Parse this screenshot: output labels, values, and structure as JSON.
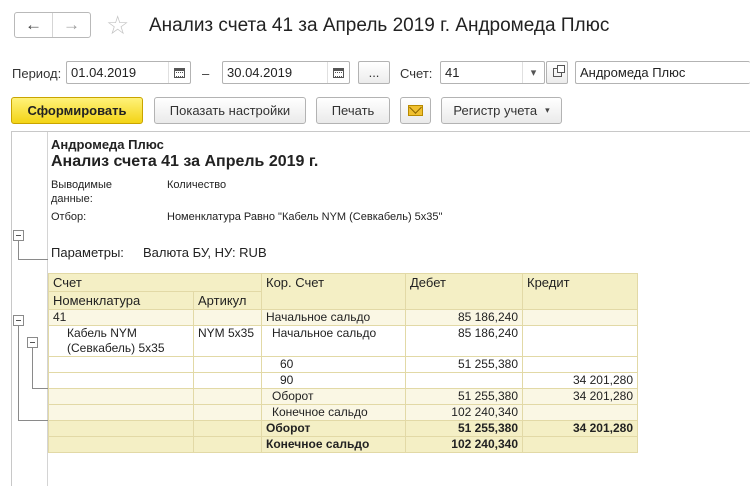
{
  "window": {
    "title": "Анализ счета 41 за Апрель 2019 г. Андромеда Плюс",
    "back_icon": "←",
    "forward_icon": "→",
    "star_icon": "☆"
  },
  "filters": {
    "period_label": "Период:",
    "date_from": "01.04.2019",
    "dash": "–",
    "date_to": "30.04.2019",
    "period_choose": "...",
    "account_label": "Счет:",
    "account_value": "41",
    "account_dropdown_icon": "▾",
    "organization": "Андромеда Плюс"
  },
  "toolbar": {
    "generate_label": "Сформировать",
    "settings_label": "Показать настройки",
    "print_label": "Печать",
    "register_label": "Регистр учета",
    "register_caret": "▾"
  },
  "report": {
    "organization": "Андромеда Плюс",
    "title": "Анализ счета 41 за Апрель 2019 г.",
    "output_label_1": "Выводимые",
    "output_label_2": "данные:",
    "output_value": "Количество",
    "filter_label": "Отбор:",
    "filter_value": "Номенклатура Равно \"Кабель NYM (Севкабель) 5х35\"",
    "params_label": "Параметры:",
    "params_value": "Валюта БУ, НУ: RUB",
    "headers": {
      "account": "Счет",
      "corr_account": "Кор. Счет",
      "debit": "Дебет",
      "credit": "Кредит",
      "nomenclature": "Номенклатура",
      "article": "Артикул"
    },
    "rows": [
      {
        "c1": "41",
        "c2": "",
        "c3": "Начальное сальдо",
        "c4": "85 186,240",
        "c5": ""
      },
      {
        "c1": "Кабель NYM",
        "c1b": "(Севкабель) 5х35",
        "c2": "NYM 5x35",
        "c3": "Начальное сальдо",
        "c4": "85 186,240",
        "c5": ""
      },
      {
        "c1": "",
        "c2": "",
        "c3": "60",
        "c4": "51 255,380",
        "c5": ""
      },
      {
        "c1": "",
        "c2": "",
        "c3": "90",
        "c4": "",
        "c5": "34 201,280"
      },
      {
        "c1": "",
        "c2": "",
        "c3": "Оборот",
        "c4": "51 255,380",
        "c5": "34 201,280"
      },
      {
        "c1": "",
        "c2": "",
        "c3": "Конечное сальдо",
        "c4": "102 240,340",
        "c5": ""
      },
      {
        "c1": "",
        "c2": "",
        "c3": "Оборот",
        "c4": "51 255,380",
        "c5": "34 201,280"
      },
      {
        "c1": "",
        "c2": "",
        "c3": "Конечное сальдо",
        "c4": "102 240,340",
        "c5": ""
      }
    ]
  }
}
